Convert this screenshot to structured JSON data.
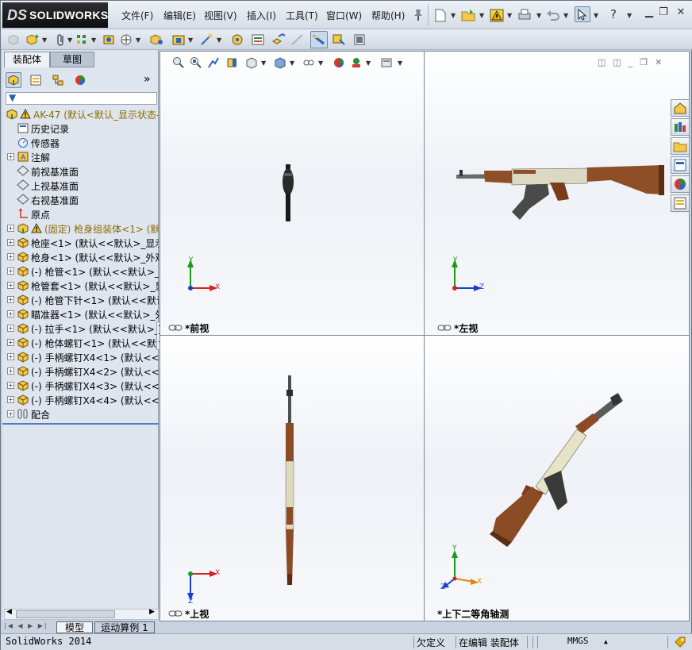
{
  "app": {
    "brand_prefix": "DS",
    "brand": "SOLIDWORKS"
  },
  "menus": [
    "文件(F)",
    "编辑(E)",
    "视图(V)",
    "插入(I)",
    "工具(T)",
    "窗口(W)",
    "帮助(H)"
  ],
  "help_symbol": "?",
  "panel_tabs": [
    "装配体",
    "草图"
  ],
  "panel_more": "»",
  "tree": [
    {
      "label": "AK-47  (默认<默认_显示状态-1>)",
      "icon": "assembly-icon",
      "warn": true,
      "expand": ""
    },
    {
      "label": "历史记录",
      "icon": "history-icon",
      "expand": ""
    },
    {
      "label": "传感器",
      "icon": "sensor-icon",
      "expand": ""
    },
    {
      "label": "注解",
      "icon": "annotation-icon",
      "expand": "+"
    },
    {
      "label": "前视基准面",
      "icon": "plane-icon",
      "expand": ""
    },
    {
      "label": "上视基准面",
      "icon": "plane-icon",
      "expand": ""
    },
    {
      "label": "右视基准面",
      "icon": "plane-icon",
      "expand": ""
    },
    {
      "label": "原点",
      "icon": "origin-icon",
      "expand": ""
    },
    {
      "label": "(固定) 枪身组装体<1> (默认<默认_显示状态-1>)",
      "icon": "subassembly-icon",
      "warn": true,
      "expand": "+"
    },
    {
      "label": "枪座<1> (默认<<默认>_显示状态 1>)",
      "icon": "part-icon",
      "expand": "+"
    },
    {
      "label": "枪身<1> (默认<<默认>_外观 显示状态>)",
      "icon": "part-icon",
      "expand": "+"
    },
    {
      "label": "(-) 枪管<1> (默认<<默认>_显示状态 1>)",
      "icon": "part-icon",
      "expand": "+"
    },
    {
      "label": "枪管套<1> (默认<<默认>_显示状态 1>)",
      "icon": "part-icon",
      "expand": "+"
    },
    {
      "label": "(-) 枪管下针<1> (默认<<默认>_显示状态 1>)",
      "icon": "part-icon",
      "expand": "+"
    },
    {
      "label": "瞄准器<1> (默认<<默认>_外观 显示状态>)",
      "icon": "part-icon",
      "expand": "+"
    },
    {
      "label": "(-) 拉手<1> (默认<<默认>_显示状态 1>)",
      "icon": "part-icon",
      "expand": "+"
    },
    {
      "label": "(-) 枪体螺钉<1> (默认<<默认>_显示状态 1>)",
      "icon": "part-icon",
      "expand": "+"
    },
    {
      "label": "(-) 手柄螺钉X4<1> (默认<<默认>_显示状态 1>)",
      "icon": "part-icon",
      "expand": "+"
    },
    {
      "label": "(-) 手柄螺钉X4<2> (默认<<默认>_显示状态 1>)",
      "icon": "part-icon",
      "expand": "+"
    },
    {
      "label": "(-) 手柄螺钉X4<3> (默认<<默认>_显示状态 1>)",
      "icon": "part-icon",
      "expand": "+"
    },
    {
      "label": "(-) 手柄螺钉X4<4> (默认<<默认>_显示状态 1>)",
      "icon": "part-icon",
      "expand": "+"
    },
    {
      "label": "配合",
      "icon": "mates-icon",
      "expand": "+"
    }
  ],
  "bottom_tabs": [
    "模型",
    "运动算例 1"
  ],
  "viewports": [
    {
      "label": "*前视",
      "axes": [
        "Y",
        "X"
      ]
    },
    {
      "label": "*左视",
      "axes": [
        "Y",
        "Z"
      ]
    },
    {
      "label": "*上视",
      "axes": [
        "X",
        "Z"
      ]
    },
    {
      "label": "*上下二等角轴测",
      "axes": [
        "Y",
        "X",
        "Z"
      ]
    }
  ],
  "status": {
    "app": "SolidWorks 2014",
    "defined": "欠定义",
    "editing": "在编辑 装配体",
    "units": "MMGS",
    "units_caret": "▲"
  },
  "colors": {
    "wood": "#8a4b25",
    "metal": "#3a3a3a",
    "receiver": "#e7e3c6",
    "accent": "#e8a000"
  }
}
